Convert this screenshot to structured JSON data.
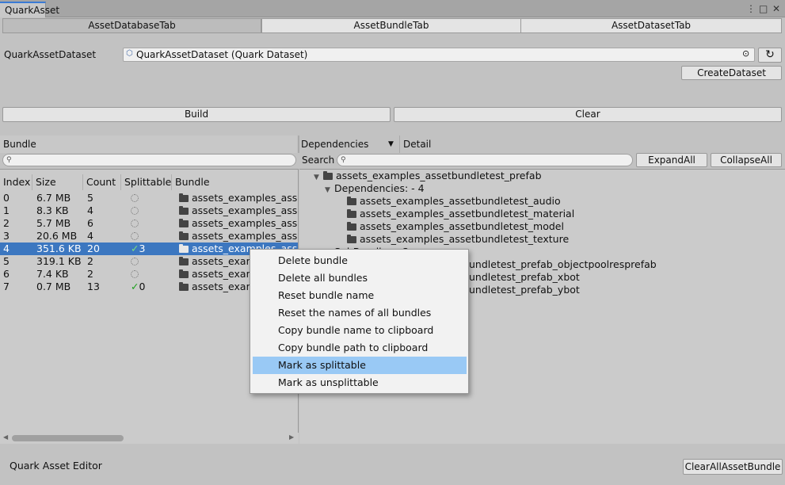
{
  "window": {
    "tab_title": "QuarkAsset",
    "icons": [
      "more-vert-icon",
      "maximize-icon",
      "close-icon"
    ]
  },
  "tabs": [
    {
      "label": "AssetDatabaseTab",
      "active": true
    },
    {
      "label": "AssetBundleTab",
      "active": false
    },
    {
      "label": "AssetDatasetTab",
      "active": false
    }
  ],
  "dataset": {
    "label": "QuarkAssetDataset",
    "value": "QuarkAssetDataset (Quark Dataset)",
    "create_label": "CreateDataset"
  },
  "actions": {
    "build": "Build",
    "clear": "Clear"
  },
  "bundle_pane": {
    "header": "Bundle",
    "columns": [
      "Index",
      "Size",
      "Count",
      "Splittable",
      "Bundle"
    ],
    "rows": [
      {
        "index": "0",
        "size": "6.7 MB",
        "count": "5",
        "splittable": false,
        "split_count": "",
        "bundle": "assets_examples_assetb"
      },
      {
        "index": "1",
        "size": "8.3 KB",
        "count": "4",
        "splittable": false,
        "split_count": "",
        "bundle": "assets_examples_assetb"
      },
      {
        "index": "2",
        "size": "5.7 MB",
        "count": "6",
        "splittable": false,
        "split_count": "",
        "bundle": "assets_examples_assetb"
      },
      {
        "index": "3",
        "size": "20.6 MB",
        "count": "4",
        "splittable": false,
        "split_count": "",
        "bundle": "assets_examples_assetb"
      },
      {
        "index": "4",
        "size": "351.6 KB",
        "count": "20",
        "splittable": true,
        "split_count": "3",
        "bundle": "assets_examples_assetb",
        "selected": true
      },
      {
        "index": "5",
        "size": "319.1 KB",
        "count": "2",
        "splittable": false,
        "split_count": "",
        "bundle": "assets_examp"
      },
      {
        "index": "6",
        "size": "7.4 KB",
        "count": "2",
        "splittable": false,
        "split_count": "",
        "bundle": "assets_examp"
      },
      {
        "index": "7",
        "size": "0.7 MB",
        "count": "13",
        "splittable": true,
        "split_count": "0",
        "bundle": "assets_examp"
      }
    ]
  },
  "detail_pane": {
    "dropdown": "Dependencies",
    "header": "Detail",
    "search_label": "Search",
    "expand_all": "ExpandAll",
    "collapse_all": "CollapseAll",
    "tree": {
      "root": "assets_examples_assetbundletest_prefab",
      "dependencies_label": "Dependencies: - 4",
      "dependencies": [
        "assets_examples_assetbundletest_audio",
        "assets_examples_assetbundletest_material",
        "assets_examples_assetbundletest_model",
        "assets_examples_assetbundletest_texture"
      ],
      "partial_label": "SubBundles - 3",
      "subbundles_visible": [
        "undletest_prefab_objectpoolresprefab",
        "undletest_prefab_xbot",
        "undletest_prefab_ybot"
      ]
    }
  },
  "context_menu": {
    "items": [
      {
        "label": "Delete bundle",
        "highlighted": false
      },
      {
        "label": "Delete all bundles",
        "highlighted": false
      },
      {
        "label": "Reset bundle name",
        "highlighted": false
      },
      {
        "label": "Reset the names of all bundles",
        "highlighted": false
      },
      {
        "label": "Copy bundle name to clipboard",
        "highlighted": false
      },
      {
        "label": "Copy bundle path to clipboard",
        "highlighted": false
      },
      {
        "label": "Mark as splittable",
        "highlighted": true
      },
      {
        "label": "Mark as unsplittable",
        "highlighted": false
      }
    ]
  },
  "footer": {
    "label": "Quark Asset Editor",
    "clear_all": "ClearAllAssetBundle"
  },
  "colors": {
    "background": "#c2c2c2",
    "selection": "#3c77c0",
    "menu_highlight": "#99c9f5",
    "check": "#1aa01a"
  }
}
